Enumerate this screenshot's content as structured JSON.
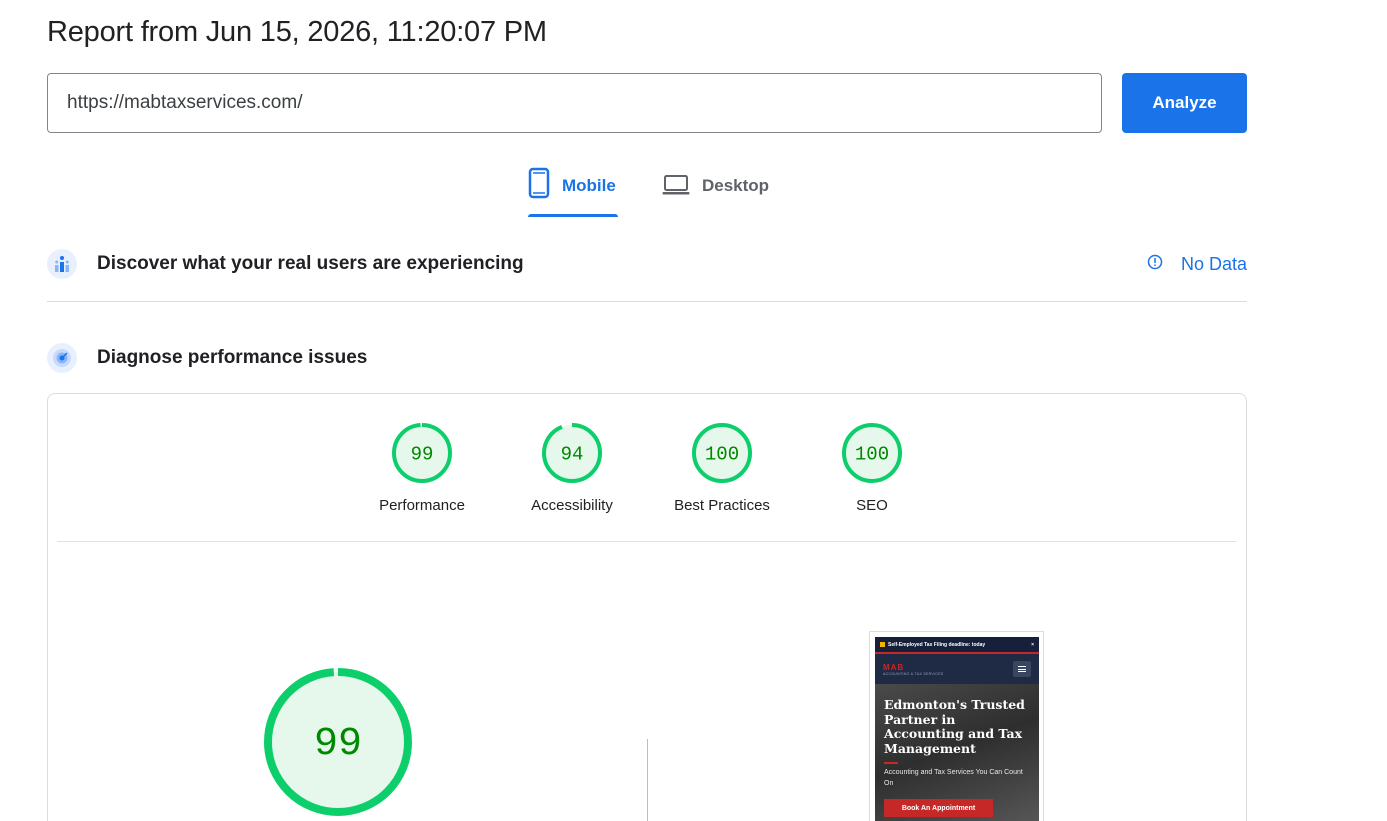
{
  "report": {
    "title": "Report from Jun 15, 2026, 11:20:07 PM"
  },
  "url_bar": {
    "value": "https://mabtaxservices.com/",
    "analyze_label": "Analyze"
  },
  "tabs": [
    {
      "label": "Mobile",
      "icon": "smartphone-icon",
      "selected": true
    },
    {
      "label": "Desktop",
      "icon": "laptop-icon",
      "selected": false
    }
  ],
  "field_data": {
    "title": "Discover what your real users are experiencing",
    "status": "No Data",
    "status_icon": "info-icon"
  },
  "lab_data": {
    "title": "Diagnose performance issues",
    "scores": [
      {
        "label": "Performance",
        "value": "99",
        "score": 99
      },
      {
        "label": "Accessibility",
        "value": "94",
        "score": 94
      },
      {
        "label": "Best Practices",
        "value": "100",
        "score": 100
      },
      {
        "label": "SEO",
        "value": "100",
        "score": 100
      }
    ],
    "main_score": {
      "value": "99",
      "score": 99
    }
  },
  "preview": {
    "banner": "Self-Employed Tax Filing deadline: today",
    "banner_close": "×",
    "logo": "MAB",
    "logo_sub": "ACCOUNTING & TAX SERVICES",
    "hero_title": "Edmonton's Trusted Partner in Accounting and Tax Management",
    "hero_subtitle": "Accounting and Tax Services You Can Count On",
    "cta": "Book An Appointment"
  },
  "colors": {
    "accent": "#1a73e8",
    "pass": "#0cce6b",
    "pass_text": "#008800",
    "pass_fill": "#e6f7ec"
  }
}
